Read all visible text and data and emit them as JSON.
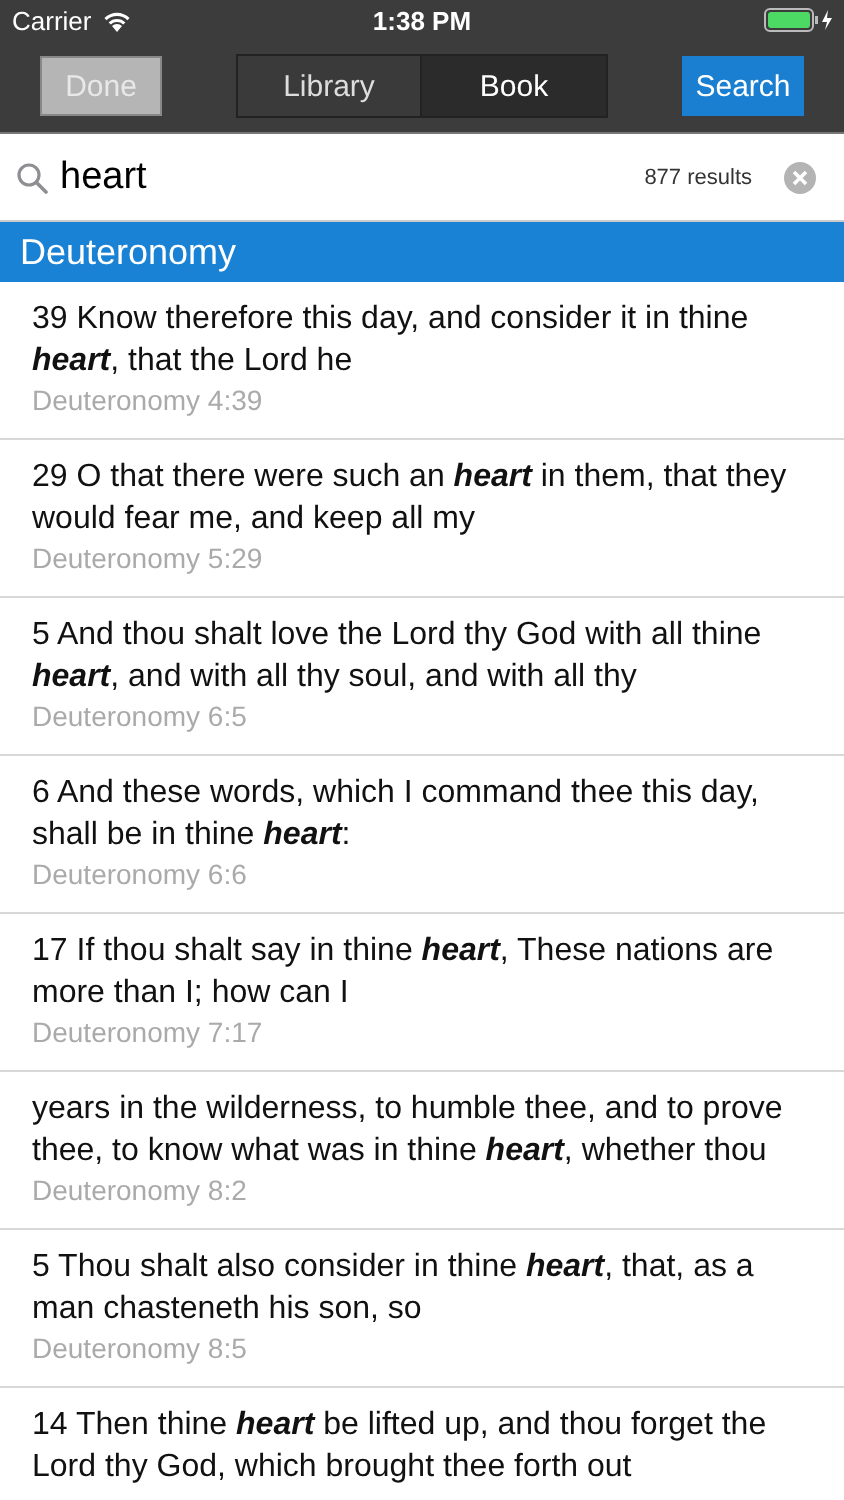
{
  "status_bar": {
    "carrier": "Carrier",
    "time": "1:38 PM"
  },
  "nav": {
    "done": {
      "label": "Done",
      "disabled": true
    },
    "segments": [
      {
        "label": "Library",
        "selected": false
      },
      {
        "label": "Book",
        "selected": true
      }
    ],
    "search_button": "Search"
  },
  "search": {
    "value": "heart",
    "count": "877 results"
  },
  "section": "Deuteronomy",
  "results": [
    {
      "text": " 39  Know therefore this day, and consider it in thine **heart**, that the Lord he",
      "ref": "Deuteronomy 4:39"
    },
    {
      "text": " 29 O that there were such an **heart** in them, that they would fear me, and keep all my",
      "ref": "Deuteronomy 5:29"
    },
    {
      "text": " 5 And thou shalt love the Lord thy God with all thine **heart**, and with all thy soul, and with all thy",
      "ref": "Deuteronomy 6:5"
    },
    {
      "text": " 6 And these words, which I command thee this day, shall be in thine **heart**:",
      "ref": "Deuteronomy 6:6"
    },
    {
      "text": " 17 If thou shalt say in thine **heart**, These nations are more than I; how can I",
      "ref": "Deuteronomy 7:17"
    },
    {
      "text": " years in the wilderness, to humble thee, and to prove thee, to know what was in thine **heart**, whether thou",
      "ref": "Deuteronomy 8:2"
    },
    {
      "text": " 5 Thou shalt also consider in thine **heart**, that, as a man chasteneth his son, so",
      "ref": "Deuteronomy 8:5"
    },
    {
      "text": " 14 Then thine **heart** be lifted up, and thou forget the Lord thy God, which brought thee forth out"
    }
  ]
}
